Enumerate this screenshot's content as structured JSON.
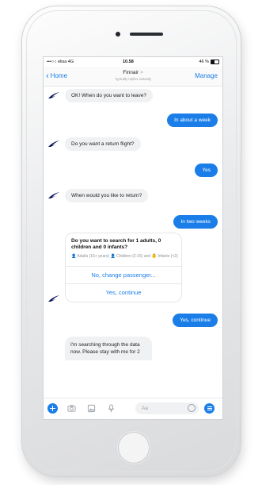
{
  "status_bar": {
    "carrier": "•••○○ elisa  4G",
    "time": "10.58",
    "battery": "46 %"
  },
  "nav": {
    "back_label": "Home",
    "title": "Finnair",
    "title_arrow": ">",
    "subtitle": "Typically replies instantly",
    "manage_label": "Manage"
  },
  "messages": [
    {
      "from": "bot",
      "text": "OK! When do you want to leave?"
    },
    {
      "from": "user",
      "text": "In about a week"
    },
    {
      "from": "bot",
      "text": "Do you want a return flight?"
    },
    {
      "from": "user",
      "text": "Yes"
    },
    {
      "from": "bot",
      "text": "When would you like to return?"
    },
    {
      "from": "user",
      "text": "In two weeks"
    },
    {
      "from": "user",
      "text": "Yes, continue"
    },
    {
      "from": "bot",
      "text": "I'm searching through the data now. Please stay with me for 2"
    }
  ],
  "card": {
    "title": "Do you want to search for 1 adults, 0 children and 0 infants?",
    "adults": "Adults (16+ years)",
    "children": "Children (2-15) and",
    "infants": "Infants (<2)",
    "button_change": "No, change passenger...",
    "button_continue": "Yes, continue"
  },
  "composer": {
    "placeholder": "Aa"
  },
  "colors": {
    "accent": "#1b7ee8",
    "bot_bubble": "#f0f1f3",
    "brand_logo": "#0b1560"
  },
  "icons": [
    "plus-icon",
    "camera-icon",
    "image-icon",
    "microphone-icon",
    "emoji-icon",
    "menu-icon",
    "finnair-logo"
  ]
}
